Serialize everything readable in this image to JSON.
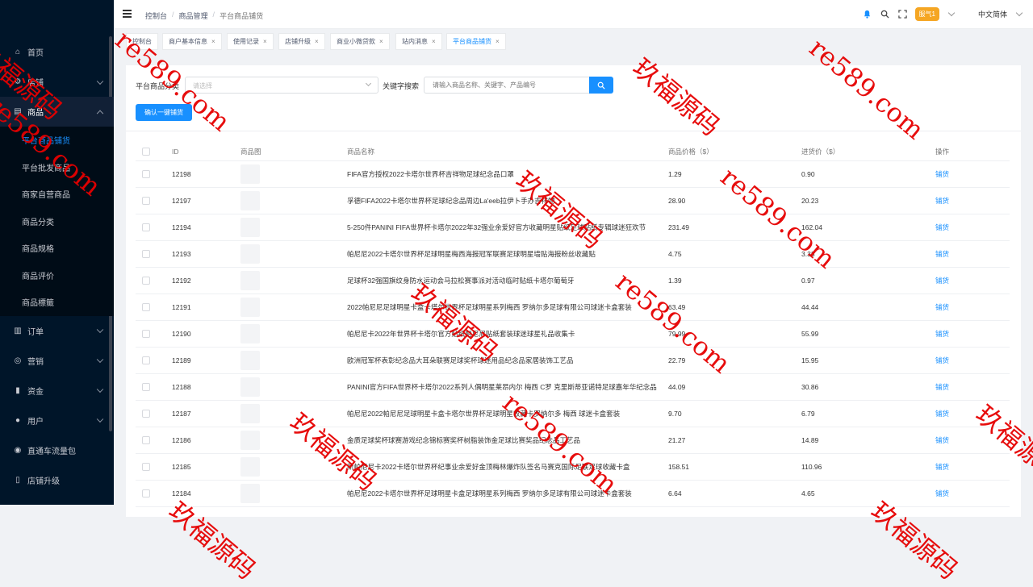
{
  "sidebar": {
    "items": [
      {
        "label": "首页",
        "icon": "home-icon"
      },
      {
        "label": "店铺",
        "icon": "gear-icon"
      },
      {
        "label": "商品",
        "icon": "bag-icon"
      },
      {
        "label": "订单",
        "icon": "doc-icon"
      },
      {
        "label": "营销",
        "icon": "target-icon"
      },
      {
        "label": "资金",
        "icon": "bar-chart-icon"
      },
      {
        "label": "用户",
        "icon": "user-icon"
      },
      {
        "label": "直通车流量包",
        "icon": "traffic-icon"
      },
      {
        "label": "店铺升级",
        "icon": "upgrade-icon"
      }
    ],
    "sub_items": [
      "平台商品铺货",
      "平台批发商品",
      "商家自营商品",
      "商品分类",
      "商品规格",
      "商品评价",
      "商品標籤"
    ]
  },
  "header": {
    "breadcrumbs": [
      "控制台",
      "商品管理",
      "平台商品铺货"
    ],
    "breadcrumb_sep": "/",
    "badge": "服气1",
    "language": "中文简体"
  },
  "tabs": [
    {
      "label": "控制台"
    },
    {
      "label": "商户基本信息"
    },
    {
      "label": "使用记录"
    },
    {
      "label": "店铺升级"
    },
    {
      "label": "商业小微贷款"
    },
    {
      "label": "站内消息"
    },
    {
      "label": "平台商品铺货"
    }
  ],
  "tab_close": "×",
  "filter": {
    "category_label": "平台商品分类",
    "category_placeholder": "请选择",
    "keyword_label": "关键字搜索",
    "keyword_placeholder": "请输入商品名称、关键字、产品编号",
    "bulk_button": "确认一键铺货"
  },
  "table": {
    "headers": {
      "id": "ID",
      "image": "商品图",
      "name": "商品名称",
      "price": "商品价格（$）",
      "cost": "进货价（$）",
      "op": "操作"
    },
    "action_label": "铺货",
    "rows": [
      {
        "id": "12198",
        "name": "FIFA官方授权2022卡塔尔世界杯吉祥物足球纪念品口罩",
        "price": "1.29",
        "cost": "0.90"
      },
      {
        "id": "12197",
        "name": "孚德FIFA2022卡塔尔世界杯足球纪念品周边La'eeb拉伊卜手办吉祥物",
        "price": "28.90",
        "cost": "20.23"
      },
      {
        "id": "12194",
        "name": "5-250件PANINI FIFA世界杯卡塔尔2022年32强业余爱好官方收藏明星贴纸足球贴纸专辑球迷狂欢节",
        "price": "231.49",
        "cost": "162.04"
      },
      {
        "id": "12193",
        "name": "帕尼尼2022卡塔尔世界杯足球明星梅西海报冠军联赛足球明星墙贴海报粉丝收藏贴",
        "price": "4.75",
        "cost": "3.33"
      },
      {
        "id": "12192",
        "name": "足球杯32强国旗纹身防水运动会马拉松赛事派对活动临时贴纸卡塔尔葡萄牙",
        "price": "1.39",
        "cost": "0.97"
      },
      {
        "id": "12191",
        "name": "2022帕尼尼足球明星卡盒卡塔尔世界杯足球明星系列梅西 罗纳尔多足球有限公司球迷卡盒套装",
        "price": "63.49",
        "cost": "44.44"
      },
      {
        "id": "12190",
        "name": "帕尼尼卡2022年世界杯卡塔尔官方贴纸帕尼尼贴纸套装球迷球星礼品收集卡",
        "price": "79.99",
        "cost": "55.99"
      },
      {
        "id": "12189",
        "name": "欧洲冠军杯表彰纪念品大耳朵联赛足球奖杯球迷用品纪念品家居装饰工艺品",
        "price": "22.79",
        "cost": "15.95"
      },
      {
        "id": "12188",
        "name": "PANINI官方FIFA世界杯卡塔尔2022系列人偶明星莱昂内尔 梅西 C罗 克里斯蒂亚诺特足球嘉年华纪念品",
        "price": "44.09",
        "cost": "30.86"
      },
      {
        "id": "12187",
        "name": "帕尼尼2022帕尼尼足球明星卡盒卡塔尔世界杯足球明星收藏卡罗纳尔多 梅西 球迷卡盒套装",
        "price": "9.70",
        "cost": "6.79"
      },
      {
        "id": "12186",
        "name": "金质足球奖杯球赛游戏纪念锦标赛奖杯树脂装饰金足球比赛奖品纪念品工艺品",
        "price": "21.27",
        "cost": "14.89"
      },
      {
        "id": "12185",
        "name": "新帕尼尼卡2022卡塔尔世界杯纪事业余爱好金顶梅林爆炸队签名马赛克国际足联足球收藏卡盒",
        "price": "158.51",
        "cost": "110.96"
      },
      {
        "id": "12184",
        "name": "帕尼尼2022卡塔尔世界杯足球明星卡盒足球明星系列梅西 罗纳尔多足球有限公司球迷卡盒套装",
        "price": "6.64",
        "cost": "4.65"
      }
    ]
  },
  "watermarks": [
    "玖福源码",
    "re589.com"
  ],
  "colors": {
    "sidebar_bg": "#001529",
    "accent": "#1890ff",
    "watermark": "#e60000",
    "badge": "#f5a623"
  }
}
